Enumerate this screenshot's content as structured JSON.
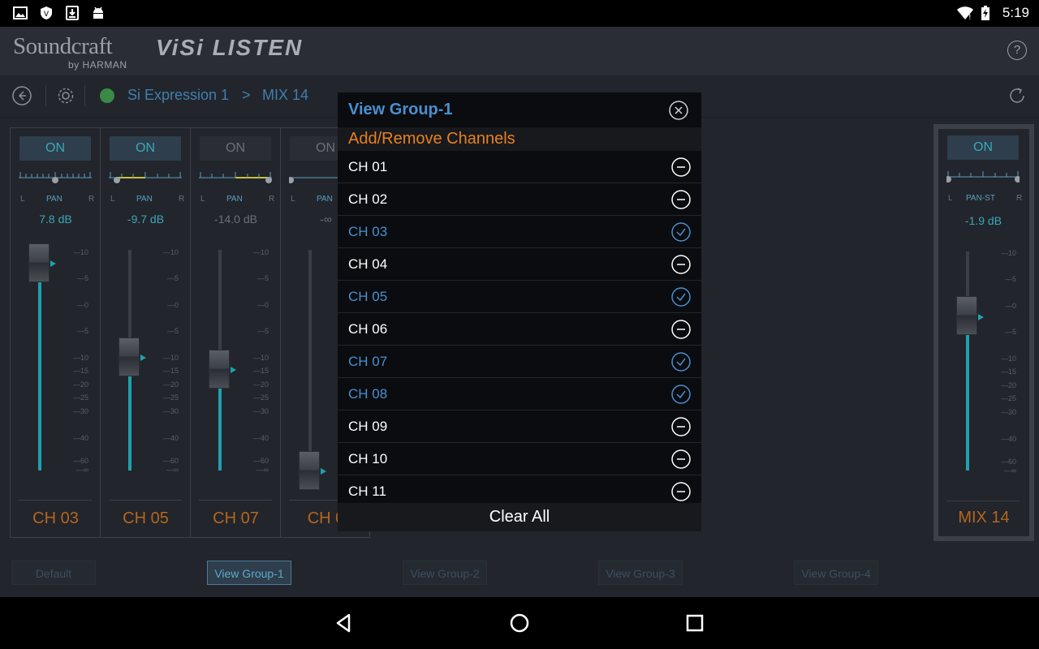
{
  "status_bar": {
    "time": "5:19",
    "icons": [
      "image-icon",
      "shield-icon",
      "download-icon",
      "android-icon",
      "wifi-icon",
      "battery-charging-icon"
    ]
  },
  "header": {
    "brand": "Soundcraft",
    "brand_sub": "by HARMAN",
    "product": "ViSi LISTEN",
    "help_label": "?"
  },
  "breadcrumb": {
    "device": "Si Expression 1",
    "separator": ">",
    "mix": "MIX 14"
  },
  "strips": [
    {
      "on_label": "ON",
      "on_active": true,
      "pan_label": "PAN",
      "l": "L",
      "r": "R",
      "gain": "7.8 dB",
      "name": "CH 03",
      "fader_level": 0.88
    },
    {
      "on_label": "ON",
      "on_active": true,
      "pan_label": "PAN",
      "l": "L",
      "r": "R",
      "gain": "-9.7 dB",
      "name": "CH 05",
      "fader_level": 0.58
    },
    {
      "on_label": "ON",
      "on_active": false,
      "pan_label": "PAN",
      "l": "L",
      "r": "R",
      "gain": "-14.0 dB",
      "name": "CH 07",
      "fader_level": 0.5
    },
    {
      "on_label": "ON",
      "on_active": false,
      "pan_label": "PAN",
      "l": "L",
      "r": "R",
      "gain": "-∞",
      "name": "CH 0",
      "fader_level": 0.0
    }
  ],
  "fader_scale": [
    "10",
    "5",
    "0",
    "5",
    "10",
    "15",
    "20",
    "25",
    "30",
    "40",
    "60",
    "∞"
  ],
  "mix_strip": {
    "on_label": "ON",
    "pan_label": "PAN-ST",
    "l": "L",
    "r": "R",
    "gain": "-1.9 dB",
    "name": "MIX 14",
    "fader_level": 0.72
  },
  "tabs": [
    {
      "label": "Default",
      "active": false
    },
    {
      "label": "View Group-1",
      "active": true
    },
    {
      "label": "View Group-2",
      "active": false
    },
    {
      "label": "View Group-3",
      "active": false
    },
    {
      "label": "View Group-4",
      "active": false
    }
  ],
  "modal": {
    "title": "View Group-1",
    "subtitle": "Add/Remove Channels",
    "clear_all": "Clear All",
    "channels": [
      {
        "label": "CH 01",
        "selected": false
      },
      {
        "label": "CH 02",
        "selected": false
      },
      {
        "label": "CH 03",
        "selected": true
      },
      {
        "label": "CH 04",
        "selected": false
      },
      {
        "label": "CH 05",
        "selected": true
      },
      {
        "label": "CH 06",
        "selected": false
      },
      {
        "label": "CH 07",
        "selected": true
      },
      {
        "label": "CH 08",
        "selected": true
      },
      {
        "label": "CH 09",
        "selected": false
      },
      {
        "label": "CH 10",
        "selected": false
      },
      {
        "label": "CH 11",
        "selected": false
      }
    ]
  },
  "colors": {
    "accent_blue": "#4a8fd0",
    "accent_orange": "#e8801e",
    "teal": "#1fa0b0",
    "strip_name": "#b5651d"
  }
}
